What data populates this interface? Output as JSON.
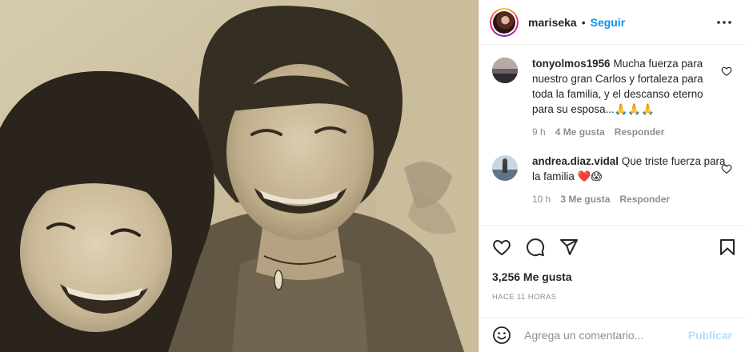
{
  "header": {
    "username": "mariseka",
    "separator": "•",
    "follow_label": "Seguir",
    "more_icon": "more-horizontal-icon"
  },
  "comments": [
    {
      "username": "tonyolmos1956",
      "text": "Mucha fuerza para nuestro gran Carlos y fortaleza para toda la familia, y el descanso eterno para su esposa...🙏🙏🙏",
      "time": "9 h",
      "likes": "4 Me gusta",
      "reply_label": "Responder"
    },
    {
      "username": "andrea.diaz.vidal",
      "text": "Que triste fuerza para la familia ❤️😱",
      "time": "10 h",
      "likes": "3 Me gusta",
      "reply_label": "Responder"
    }
  ],
  "actions": {
    "like_icon": "heart-icon",
    "comment_icon": "comment-icon",
    "share_icon": "send-icon",
    "save_icon": "bookmark-icon"
  },
  "likes_text": "3,256 Me gusta",
  "timestamp": "HACE 11 HORAS",
  "composer": {
    "placeholder": "Agrega un comentario...",
    "publish_label": "Publicar",
    "emoji_icon": "emoji-icon"
  },
  "colors": {
    "accent": "#0095f6",
    "publish_disabled": "#b2dffc",
    "muted": "#8e8e8e",
    "heart_red": "#e0245e"
  }
}
